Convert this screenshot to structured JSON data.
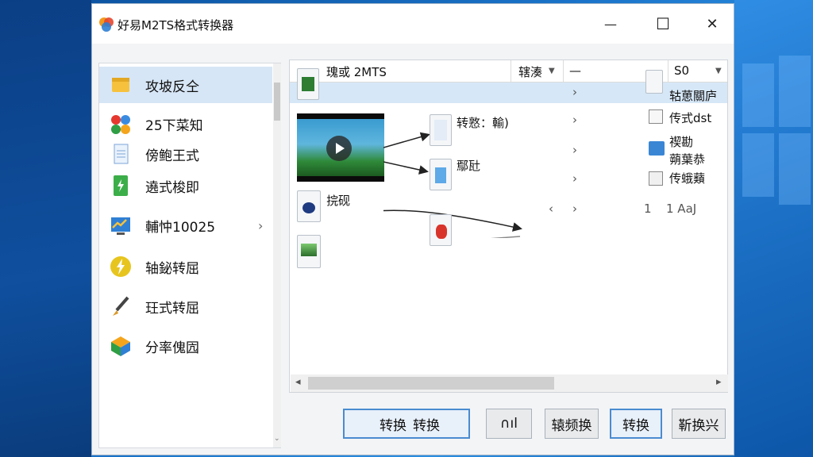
{
  "window": {
    "title": "好易M2TS格式转换器",
    "controls": {
      "minimize": "—",
      "maximize": "☐",
      "close": "✕"
    }
  },
  "sidebar": {
    "items": [
      {
        "label": "攻坡反仝",
        "icon": "folder-icon",
        "active": true
      },
      {
        "label": "25下菜知",
        "icon": "pinwheel-icon"
      },
      {
        "label": "傍鲍王式",
        "icon": "document-icon"
      },
      {
        "label": "遶式梭即",
        "icon": "green-doc-icon"
      },
      {
        "label": "輔忡10025",
        "icon": "chart-icon",
        "arrow": "›"
      },
      {
        "label": "轴鉍转屈",
        "icon": "lightning-icon"
      },
      {
        "label": "玨式转屈",
        "icon": "brush-icon"
      },
      {
        "label": "分率傀囥",
        "icon": "cube-icon"
      }
    ]
  },
  "main": {
    "header": {
      "name": "瑰或 2MTS",
      "col2": "辖湊",
      "col3": "—",
      "col4": "S0"
    },
    "rows": [
      {
        "text": "转憝：輸)",
        "chev": "›"
      },
      {
        "text": "鄢瓧",
        "chev": "›"
      },
      {
        "text": "捖砚",
        "chev_left": "‹",
        "chev_right": "›"
      },
      {
        "chev": "›"
      }
    ],
    "right_list": [
      {
        "label": "轱葸關庐"
      },
      {
        "label": "传式dst"
      },
      {
        "label": "禊勘"
      },
      {
        "label": "蒴葉恭"
      },
      {
        "label": "传蛾蘱"
      }
    ],
    "right_numbers": {
      "a": "1",
      "b": "1 AaJ"
    }
  },
  "buttons": {
    "b1": "转换",
    "b2": "转换",
    "b3": "∩ıl",
    "b4": "辕频换",
    "b5": "转换",
    "b6": "靳换兴"
  },
  "colors": {
    "accent": "#4a8bd0",
    "selection": "#d6e7f7",
    "sidebar_active": "#d7e6f6"
  }
}
